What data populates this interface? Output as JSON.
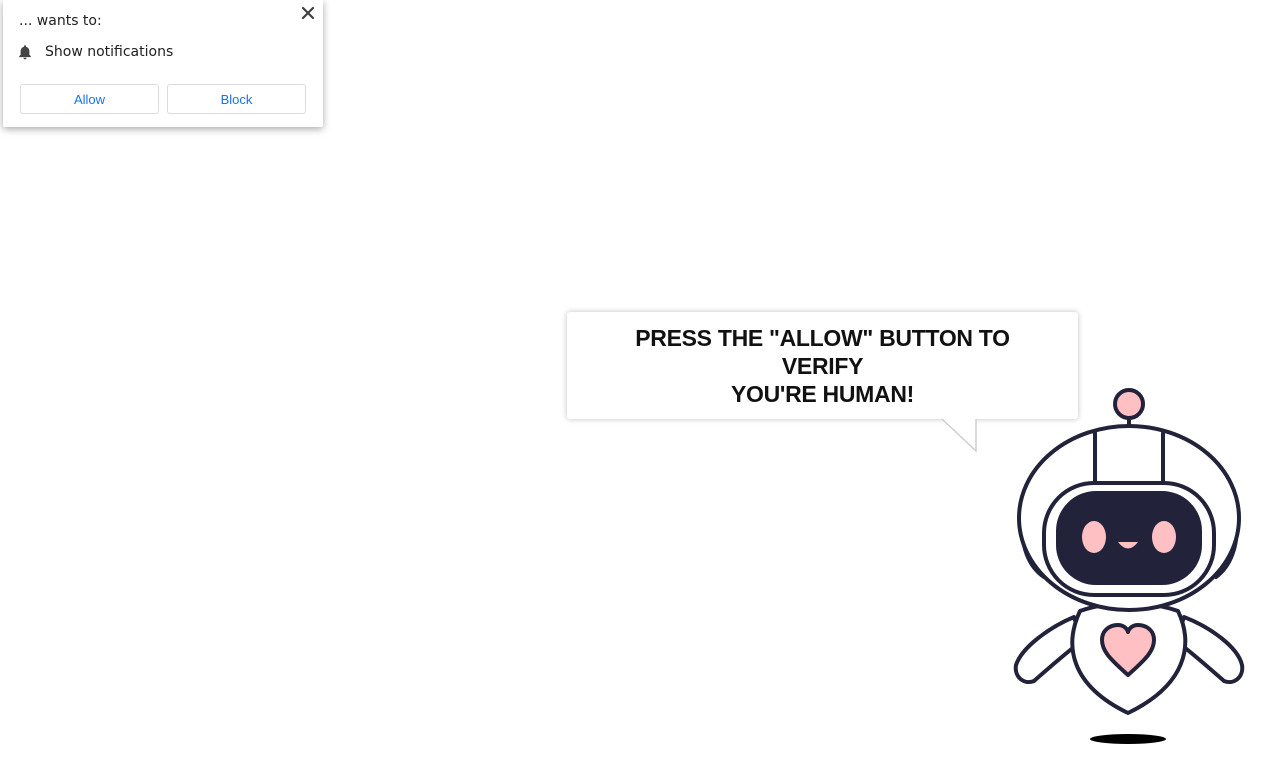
{
  "permission_popup": {
    "title": "... wants to:",
    "permission_label": "Show notifications",
    "permission_icon": "bell-icon",
    "close_icon": "close-icon",
    "allow_label": "Allow",
    "block_label": "Block",
    "button_text_color": "#1a73e8"
  },
  "bubble": {
    "line1": "PRESS THE \"ALLOW\" BUTTON TO VERIFY",
    "line2": "YOU'RE HUMAN!"
  },
  "robot": {
    "icon": "robot-mascot",
    "outline_color": "#22223a",
    "accent_color": "#ffc0c4",
    "visor_color": "#22223a"
  }
}
